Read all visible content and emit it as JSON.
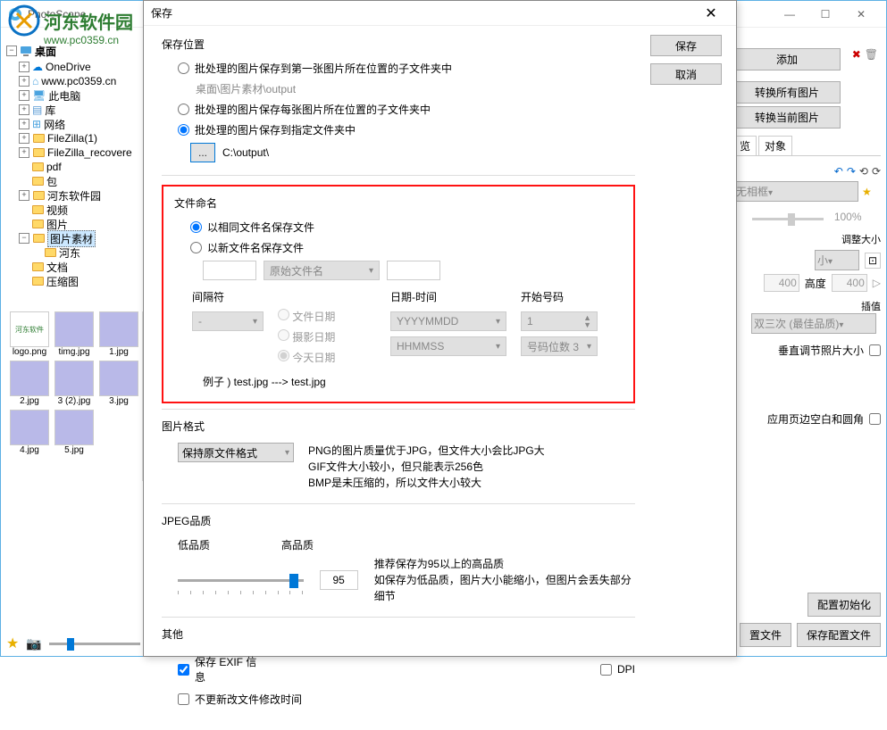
{
  "main_window": {
    "title": "PhotoScape",
    "win_min": "—",
    "win_max": "☐",
    "win_close": "✕"
  },
  "watermark": {
    "text": "河东软件园",
    "url": "www.pc0359.cn"
  },
  "tree": {
    "root": "桌面",
    "items": [
      {
        "label": "OneDrive",
        "icon": "cloud"
      },
      {
        "label": "www.pc0359.cn",
        "icon": "home"
      },
      {
        "label": "此电脑",
        "icon": "pc"
      },
      {
        "label": "库",
        "icon": "lib"
      },
      {
        "label": "网络",
        "icon": "net"
      },
      {
        "label": "FileZilla(1)"
      },
      {
        "label": "FileZilla_recovere"
      },
      {
        "label": "pdf"
      },
      {
        "label": "包"
      },
      {
        "label": "河东软件园"
      },
      {
        "label": "视频"
      },
      {
        "label": "图片"
      },
      {
        "label": "图片素材",
        "selected": true,
        "expanded": true
      },
      {
        "label": "河东",
        "indent": 3
      },
      {
        "label": "文档"
      },
      {
        "label": "压缩图"
      }
    ]
  },
  "thumbs": [
    [
      "logo.png",
      "timg.jpg",
      "1.jpg"
    ],
    [
      "2.jpg",
      "3 (2).jpg",
      "3.jpg"
    ],
    [
      "4.jpg",
      "5.jpg",
      ""
    ]
  ],
  "right_panel": {
    "add": "添加",
    "convert_all": "转换所有图片",
    "convert_cur": "转换当前图片",
    "tab1": "览",
    "tab2": "对象",
    "frame_label": "无相框",
    "zoom": "100%",
    "resize_title": "调整大小",
    "size_small": "小",
    "dim1_label": "",
    "dim1_val": "400",
    "dim2_label": "高度",
    "dim2_val": "400",
    "interp_title": "插值",
    "interp_val": "双三次 (最佳品质)",
    "vert_adj": "垂直调节照片大小",
    "margin": "应用页边空白和圆角",
    "cfg_init": "配置初始化",
    "cfg_file": "置文件",
    "save_cfg": "保存配置文件"
  },
  "dialog": {
    "title": "保存",
    "save_btn": "保存",
    "cancel_btn": "取消",
    "loc": {
      "header": "保存位置",
      "opt1": "批处理的图片保存到第一张图片所在位置的子文件夹中",
      "opt1_sub": "桌面\\图片素材\\output",
      "opt2": "批处理的图片保存每张图片所在位置的子文件夹中",
      "opt3": "批处理的图片保存到指定文件夹中",
      "browse": "...",
      "path": "C:\\output\\"
    },
    "naming": {
      "header": "文件命名",
      "opt1": "以相同文件名保存文件",
      "opt2": "以新文件名保存文件",
      "original": "原始文件名",
      "sep_label": "间隔符",
      "sep_val": "-",
      "file_date": "文件日期",
      "shot_date": "摄影日期",
      "today": "今天日期",
      "dt_label": "日期-时间",
      "dt1": "YYYYMMDD",
      "dt2": "HHMMSS",
      "start_label": "开始号码",
      "start_val": "1",
      "digits": "号码位数 3",
      "example": "例子 ) test.jpg ---> test.jpg"
    },
    "fmt": {
      "header": "图片格式",
      "keep": "保持原文件格式",
      "line1": "PNG的图片质量优于JPG，但文件大小会比JPG大",
      "line2": "GIF文件大小较小，但只能表示256色",
      "line3": "BMP是未压缩的，所以文件大小较大"
    },
    "jpeg": {
      "header": "JPEG品质",
      "low": "低品质",
      "high": "高品质",
      "val": "95",
      "tip1": "推荐保存为95以上的高品质",
      "tip2": "如保存为低品质，图片大小能缩小，但图片会丢失部分细节"
    },
    "other": {
      "header": "其他",
      "exif": "保存 EXIF 信息",
      "dpi": "DPI",
      "nomtime": "不更新改文件修改时间"
    }
  }
}
